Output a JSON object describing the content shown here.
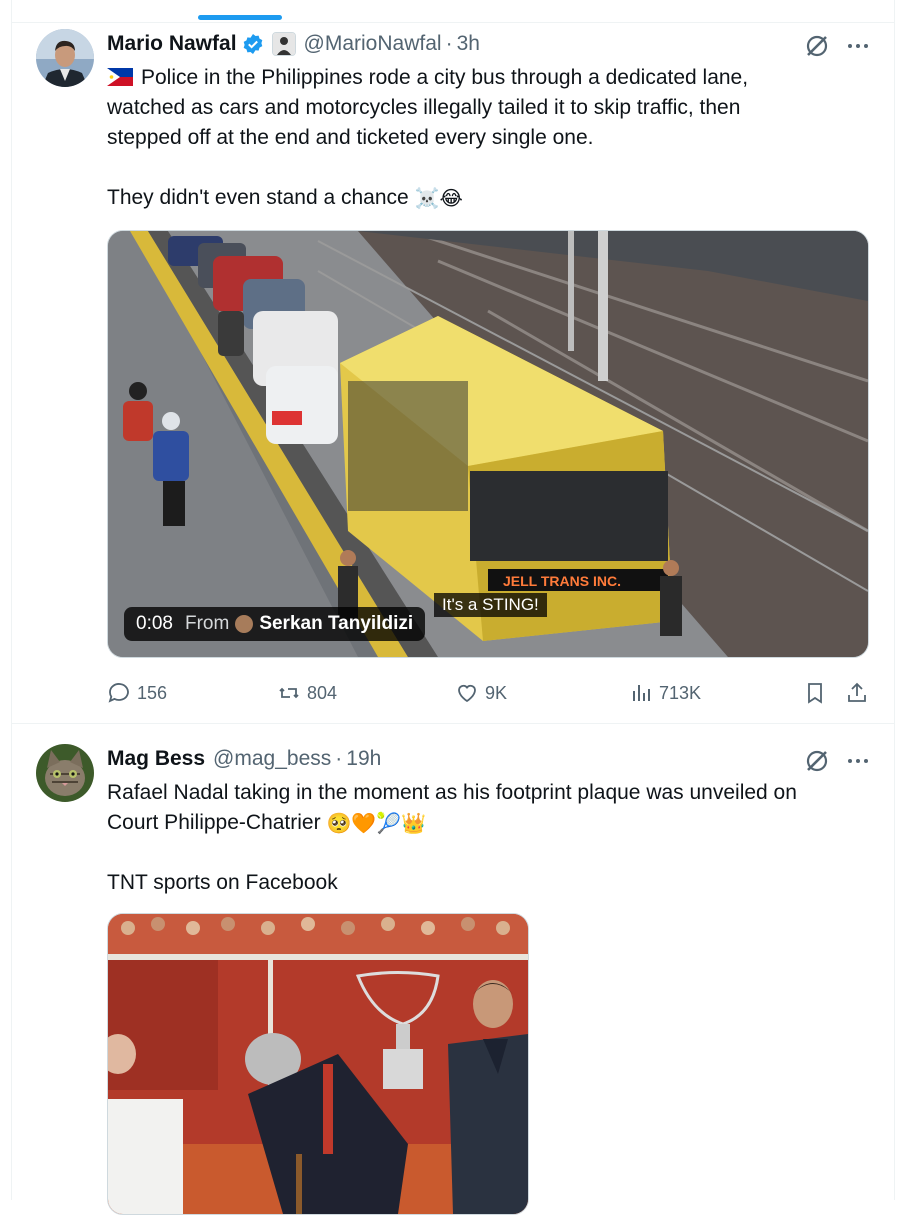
{
  "tweets": [
    {
      "name": "Mario Nawfal",
      "handle": "@MarioNawfal",
      "separator": "·",
      "time": "3h",
      "text_lines": [
        "Police in the Philippines rode a city bus through a dedicated lane,",
        "watched as cars and motorcycles illegally tailed it to skip traffic, then",
        "stepped off at the end and ticketed every single one."
      ],
      "text_flag": "philippines-flag",
      "text_second": "They didn't even stand a chance",
      "text_second_emoji": "☠️😂",
      "video": {
        "duration": "0:08",
        "from_label": "From",
        "source": "Serkan Tanyildizi",
        "caption": "It's a STING!",
        "bus_sign": "JELL TRANS INC."
      },
      "stats": {
        "replies": "156",
        "reposts": "804",
        "likes": "9K",
        "views": "713K"
      }
    },
    {
      "name": "Mag Bess",
      "handle": "@mag_bess",
      "separator": "·",
      "time": "19h",
      "text_lines": [
        "Rafael Nadal taking in the moment as his footprint plaque was unveiled on",
        "Court Philippe-Chatrier"
      ],
      "text_emoji": "🥺🧡🎾👑",
      "text_second": "TNT sports on Facebook"
    }
  ],
  "icons": {
    "verified": "verified-badge-icon",
    "affiliate": "affiliate-badge-icon",
    "grok": "grok-icon",
    "more": "more-icon",
    "reply": "reply-icon",
    "repost": "repost-icon",
    "like": "heart-icon",
    "views": "views-icon",
    "bookmark": "bookmark-icon",
    "share": "share-icon"
  },
  "colors": {
    "accent": "#1d9bf0",
    "text": "#0f1419",
    "secondary": "#536471",
    "border": "#eff3f4"
  }
}
